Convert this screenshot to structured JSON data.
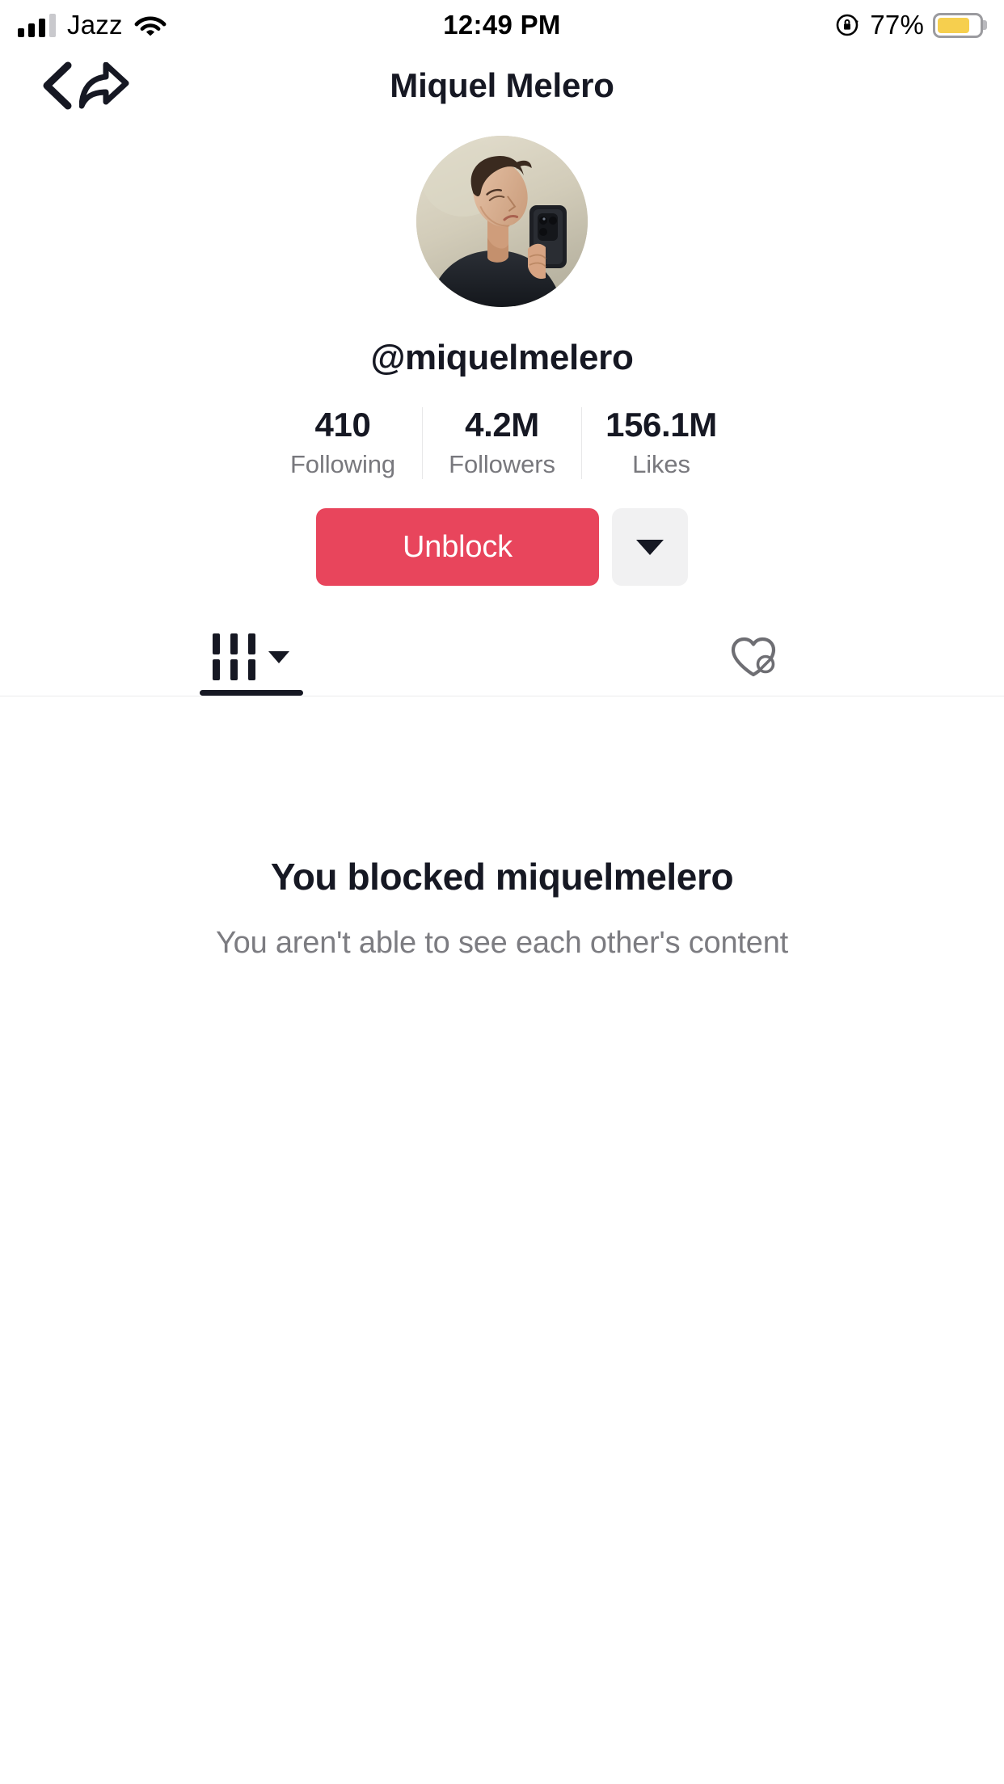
{
  "status_bar": {
    "carrier": "Jazz",
    "time": "12:49 PM",
    "battery_percent": "77%",
    "battery_level": 77,
    "signal_bars_filled": 3,
    "signal_bars_total": 4,
    "wifi_icon": "wifi-icon",
    "rotation_lock_icon": "rotation-lock-icon",
    "battery_icon": "battery-icon",
    "battery_color": "#f6cf4e"
  },
  "nav": {
    "back_icon": "chevron-left-icon",
    "title": "Miquel Melero",
    "share_icon": "share-arrow-icon"
  },
  "profile": {
    "avatar_icon": "avatar-photo",
    "handle": "@miquelmelero",
    "stats": [
      {
        "value": "410",
        "label": "Following"
      },
      {
        "value": "4.2M",
        "label": "Followers"
      },
      {
        "value": "156.1M",
        "label": "Likes"
      }
    ]
  },
  "actions": {
    "unblock_label": "Unblock",
    "unblock_color": "#e8455c",
    "more_icon": "caret-down-icon",
    "more_bg": "#f1f1f2"
  },
  "tabs": [
    {
      "id": "videos",
      "icon": "grid-icon",
      "caret": "caret-down-icon",
      "active": true
    },
    {
      "id": "liked",
      "icon": "heart-slash-icon",
      "active": false
    }
  ],
  "empty_state": {
    "title": "You blocked miquelmelero",
    "subtitle": "You aren't able to see each other's content"
  }
}
